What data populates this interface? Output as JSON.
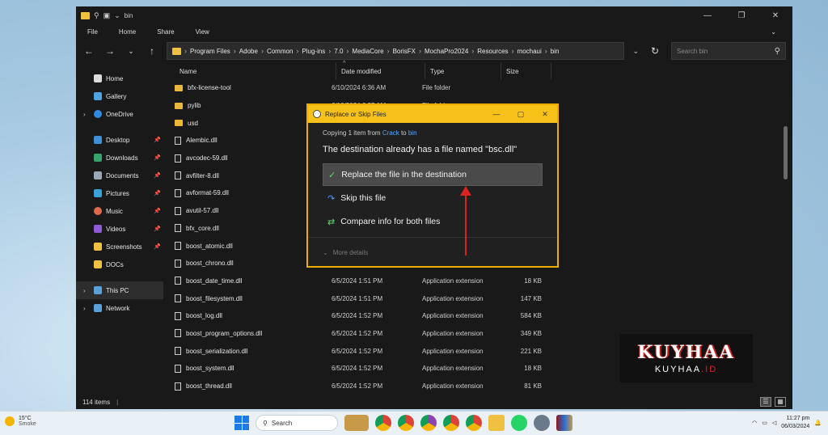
{
  "titlebar": {
    "title": "bin"
  },
  "ribbon": [
    "File",
    "Home",
    "Share",
    "View"
  ],
  "address": {
    "segments": [
      "Program Files",
      "Adobe",
      "Common",
      "Plug-ins",
      "7.0",
      "MediaCore",
      "BorisFX",
      "MochaPro2024",
      "Resources",
      "mochaui",
      "bin"
    ]
  },
  "search": {
    "placeholder": "Search bin"
  },
  "sidebar": {
    "items": [
      "Home",
      "Gallery",
      "OneDrive",
      "Desktop",
      "Downloads",
      "Documents",
      "Pictures",
      "Music",
      "Videos",
      "Screenshots",
      "DOCs",
      "This PC",
      "Network"
    ]
  },
  "columns": {
    "name": "Name",
    "date": "Date modified",
    "type": "Type",
    "size": "Size"
  },
  "files": [
    {
      "name": "bfx-license-tool",
      "date": "6/10/2024 6:36 AM",
      "type": "File folder",
      "size": "",
      "kind": "folder"
    },
    {
      "name": "pylib",
      "date": "6/10/2024 6:37 AM",
      "type": "File folder",
      "size": "",
      "kind": "folder"
    },
    {
      "name": "usd",
      "date": "",
      "type": "",
      "size": "",
      "kind": "folder"
    },
    {
      "name": "Alembic.dll",
      "date": "",
      "type": "",
      "size": "",
      "kind": "file"
    },
    {
      "name": "avcodec-59.dll",
      "date": "",
      "type": "",
      "size": "",
      "kind": "file"
    },
    {
      "name": "avfilter-8.dll",
      "date": "",
      "type": "",
      "size": "",
      "kind": "file"
    },
    {
      "name": "avformat-59.dll",
      "date": "",
      "type": "",
      "size": "",
      "kind": "file"
    },
    {
      "name": "avutil-57.dll",
      "date": "",
      "type": "",
      "size": "",
      "kind": "file"
    },
    {
      "name": "bfx_core.dll",
      "date": "",
      "type": "",
      "size": "",
      "kind": "file"
    },
    {
      "name": "boost_atomic.dll",
      "date": "",
      "type": "",
      "size": "",
      "kind": "file"
    },
    {
      "name": "boost_chrono.dll",
      "date": "",
      "type": "",
      "size": "",
      "kind": "file"
    },
    {
      "name": "boost_date_time.dll",
      "date": "6/5/2024 1:51 PM",
      "type": "Application extension",
      "size": "18 KB",
      "kind": "file"
    },
    {
      "name": "boost_filesystem.dll",
      "date": "6/5/2024 1:51 PM",
      "type": "Application extension",
      "size": "147 KB",
      "kind": "file"
    },
    {
      "name": "boost_log.dll",
      "date": "6/5/2024 1:52 PM",
      "type": "Application extension",
      "size": "584 KB",
      "kind": "file"
    },
    {
      "name": "boost_program_options.dll",
      "date": "6/5/2024 1:52 PM",
      "type": "Application extension",
      "size": "349 KB",
      "kind": "file"
    },
    {
      "name": "boost_serialization.dll",
      "date": "6/5/2024 1:52 PM",
      "type": "Application extension",
      "size": "221 KB",
      "kind": "file"
    },
    {
      "name": "boost_system.dll",
      "date": "6/5/2024 1:52 PM",
      "type": "Application extension",
      "size": "18 KB",
      "kind": "file"
    },
    {
      "name": "boost_thread.dll",
      "date": "6/5/2024 1:52 PM",
      "type": "Application extension",
      "size": "81 KB",
      "kind": "file"
    }
  ],
  "status": {
    "count": "114 items"
  },
  "dialog": {
    "title": "Replace or Skip Files",
    "copy_prefix": "Copying 1 item from",
    "from": "Crack",
    "to_word": "to",
    "to": "bin",
    "message": "The destination already has a file named \"bsc.dll\"",
    "opt_replace": "Replace the file in the destination",
    "opt_skip": "Skip this file",
    "opt_compare": "Compare info for both files",
    "more": "More details"
  },
  "brand": {
    "main": "KUYHAA",
    "sub_a": "KUYHAA",
    "sub_b": ".ID"
  },
  "taskbar": {
    "temp": "15°C",
    "weather": "Smoke",
    "search": "Search",
    "time": "11:27 pm",
    "date": "06/03/2024"
  },
  "colors": {
    "accent": "#f6c21a",
    "arrow": "#d8231f",
    "link": "#5aa9ff"
  }
}
